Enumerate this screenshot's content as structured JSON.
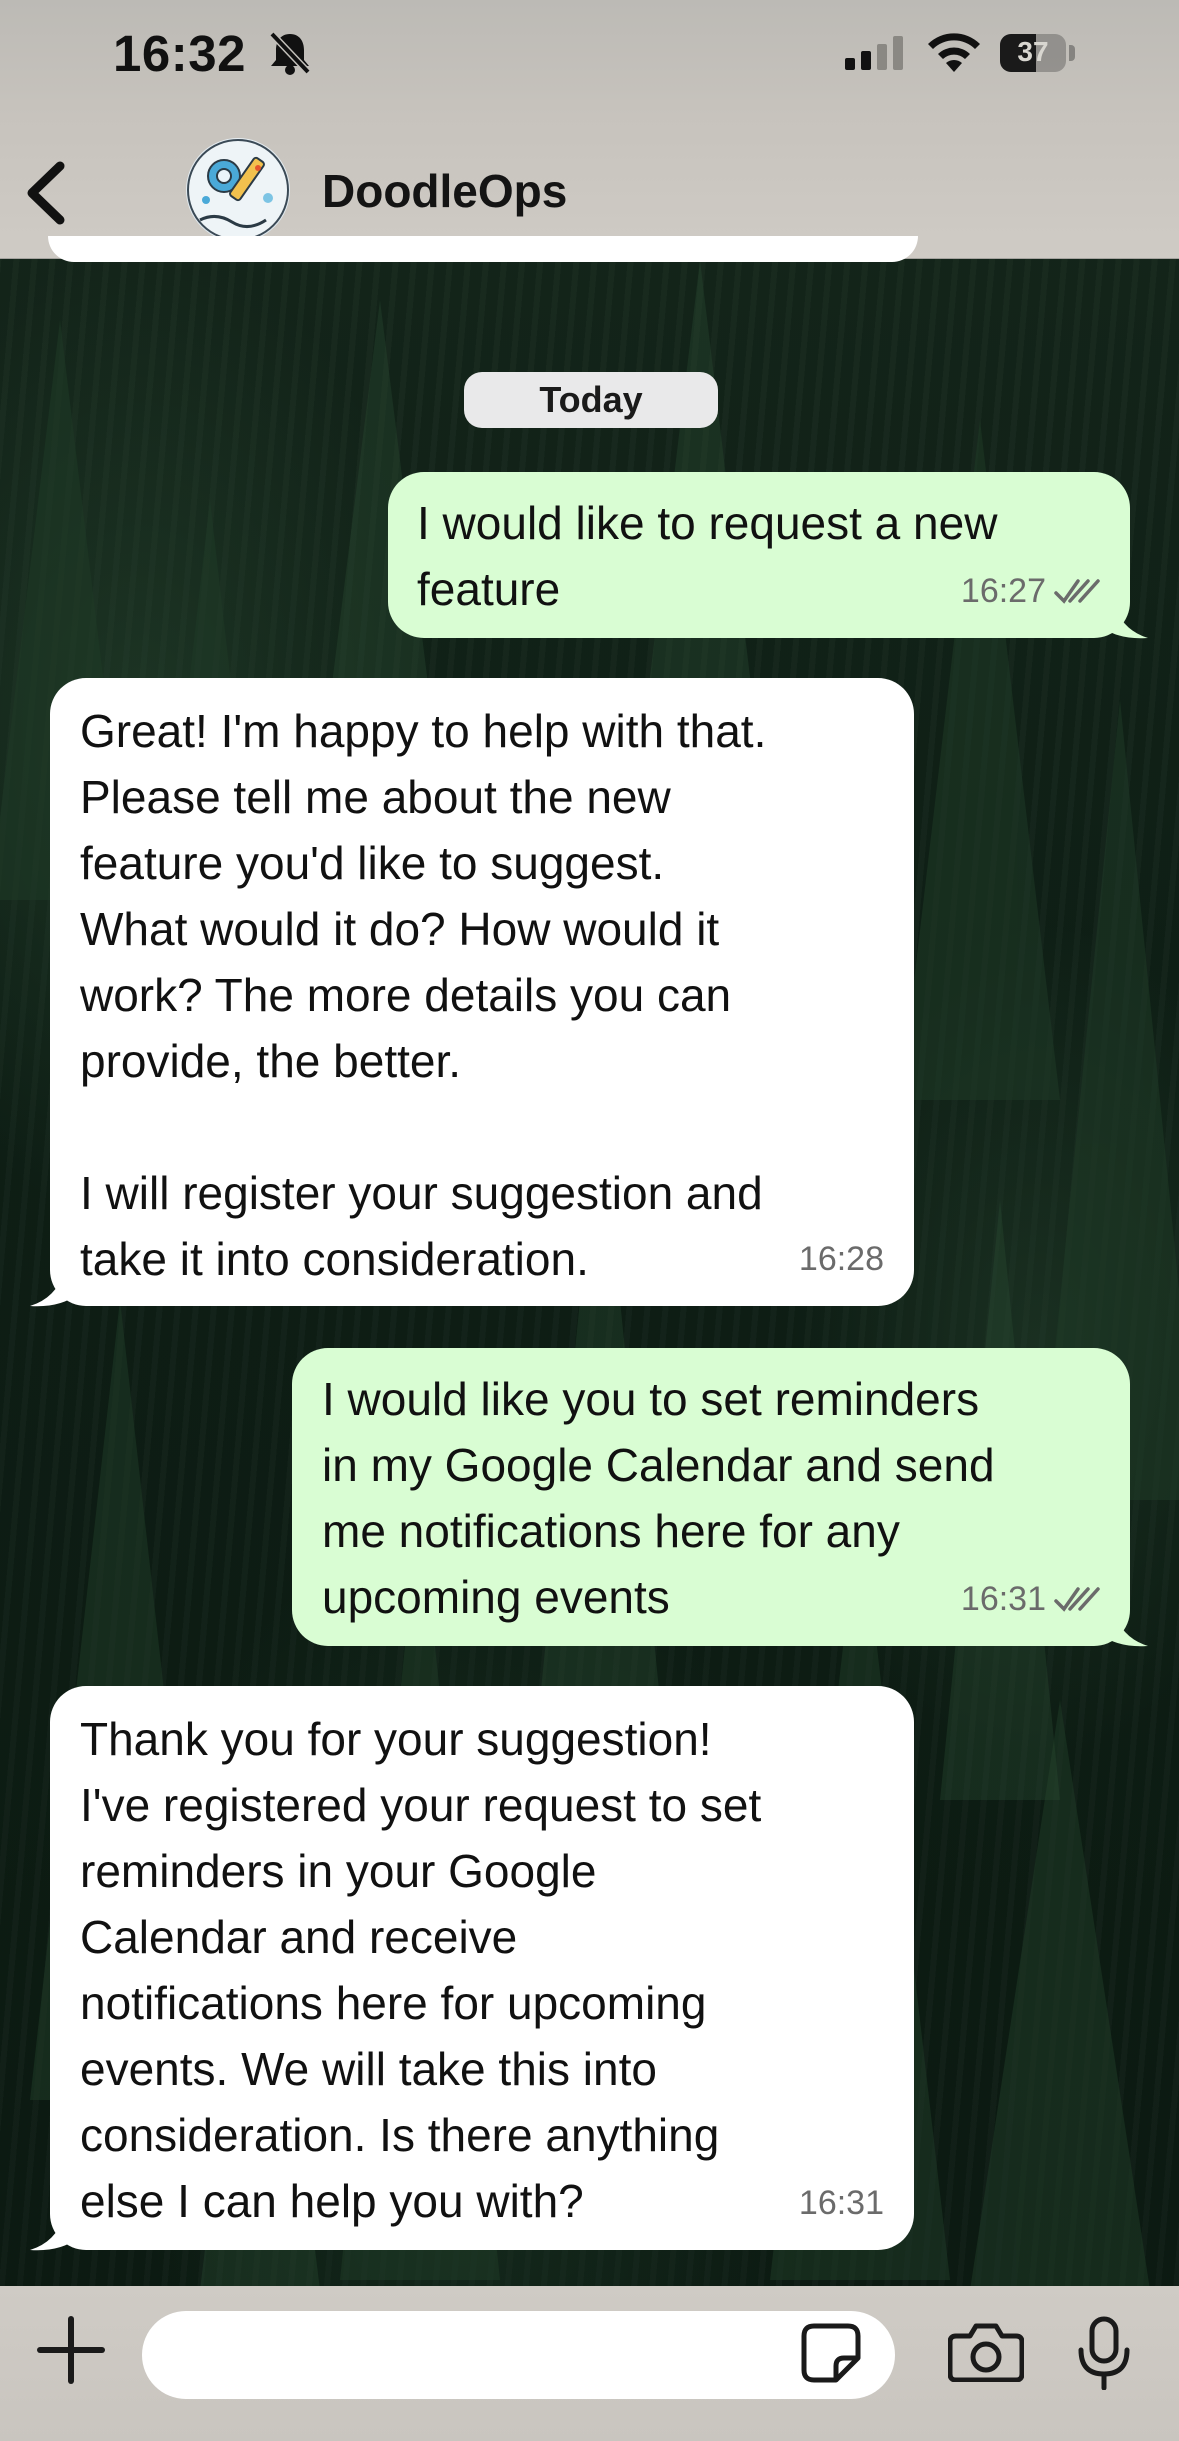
{
  "status_bar": {
    "time": "16:32",
    "battery_level": "37",
    "icons": [
      "bell-muted-icon",
      "signal-icon",
      "wifi-icon",
      "battery-icon"
    ]
  },
  "header": {
    "contact_name": "DoodleOps",
    "icons": [
      "back-chevron-icon",
      "avatar"
    ]
  },
  "chat": {
    "date_separator": "Today",
    "messages": [
      {
        "direction": "outgoing",
        "text": "I would like to request a new\nfeature",
        "time": "16:27",
        "read": true
      },
      {
        "direction": "incoming",
        "text": "Great! I'm happy to help with that.\nPlease tell me about the new\nfeature you'd like to suggest.\nWhat would it do? How would it\nwork? The more details you can\nprovide, the better.\n\nI will register your suggestion and\ntake it into consideration.",
        "time": "16:28"
      },
      {
        "direction": "outgoing",
        "text": "I would like you to set reminders\nin my Google Calendar and send\nme notifications here for any\nupcoming events",
        "time": "16:31",
        "read": true
      },
      {
        "direction": "incoming",
        "text": "Thank you for your suggestion!\nI've registered your request to set\nreminders in your Google\nCalendar and receive\nnotifications here for upcoming\nevents. We will take this into\nconsideration. Is there anything\nelse I can help you with?",
        "time": "16:31"
      }
    ]
  },
  "composer": {
    "input_value": "",
    "icons": [
      "plus-icon",
      "sticker-icon",
      "camera-icon",
      "microphone-icon"
    ]
  },
  "colors": {
    "outgoing_bubble": "#d9fdd3",
    "incoming_bubble": "#ffffff",
    "header_bg": "#c7c3bd",
    "read_ticks": "#6b6b6b"
  }
}
